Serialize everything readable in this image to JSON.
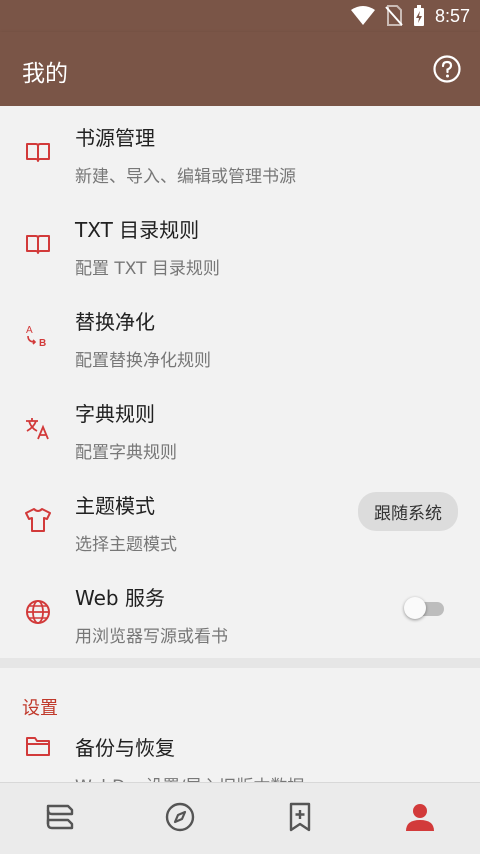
{
  "status": {
    "time": "8:57"
  },
  "appbar": {
    "title": "我的",
    "help_icon": "help-circle-icon"
  },
  "colors": {
    "primary": "#7a5547",
    "accent": "#d23a3a",
    "background": "#f2f2f2"
  },
  "items": [
    {
      "title": "书源管理",
      "subtitle": "新建、导入、编辑或管理书源",
      "icon": "book-open-icon"
    },
    {
      "title": "TXT 目录规则",
      "subtitle": "配置 TXT 目录规则",
      "icon": "book-open-icon"
    },
    {
      "title": "替换净化",
      "subtitle": "配置替换净化规则",
      "icon": "swap-ab-icon"
    },
    {
      "title": "字典规则",
      "subtitle": "配置字典规则",
      "icon": "translate-icon"
    },
    {
      "title": "主题模式",
      "subtitle": "选择主题模式",
      "icon": "shirt-icon",
      "chip": "跟随系统"
    },
    {
      "title": "Web 服务",
      "subtitle": "用浏览器写源或看书",
      "icon": "globe-icon",
      "toggle": false
    }
  ],
  "settings": {
    "header": "设置",
    "items": [
      {
        "title": "备份与恢复",
        "subtitle": "WebDav设置/导入旧版本数据",
        "icon": "folder-icon"
      }
    ]
  },
  "bottom_nav": [
    {
      "name": "bookshelf",
      "icon": "bookshelf-icon",
      "active": false
    },
    {
      "name": "discover",
      "icon": "compass-icon",
      "active": false
    },
    {
      "name": "rss",
      "icon": "bookmark-add-icon",
      "active": false
    },
    {
      "name": "my",
      "icon": "person-icon",
      "active": true
    }
  ]
}
